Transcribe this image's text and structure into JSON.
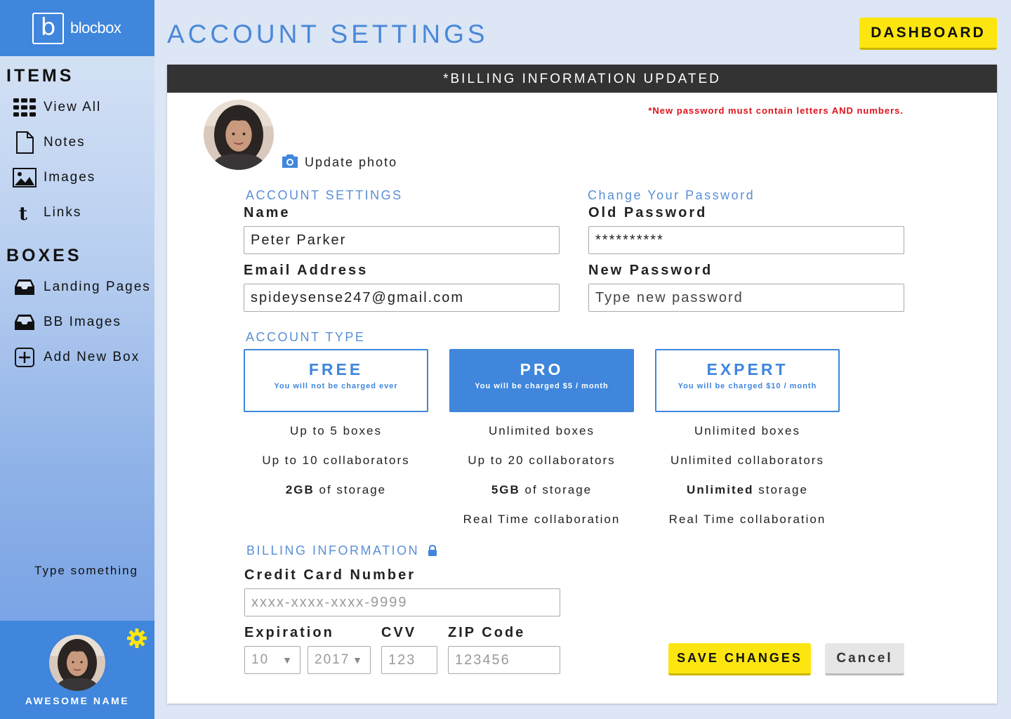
{
  "brand": {
    "logo_letter": "b",
    "name": "blocbox"
  },
  "sidebar": {
    "items_heading": "ITEMS",
    "items": [
      {
        "label": "View All",
        "icon": "grid-icon"
      },
      {
        "label": "Notes",
        "icon": "document-icon"
      },
      {
        "label": "Images",
        "icon": "image-icon"
      },
      {
        "label": "Links",
        "icon": "tumblr-icon"
      }
    ],
    "boxes_heading": "BOXES",
    "boxes": [
      {
        "label": "Landing Pages",
        "icon": "inbox-icon"
      },
      {
        "label": "BB Images",
        "icon": "inbox-icon"
      },
      {
        "label": "Add New Box",
        "icon": "plus-square-icon"
      }
    ],
    "input_placeholder": "Type something",
    "profile_name": "AWESOME NAME"
  },
  "header": {
    "title": "ACCOUNT SETTINGS",
    "dashboard_label": "DASHBOARD"
  },
  "banner": "*BILLING INFORMATION UPDATED",
  "password_warning": "*New password must contain letters AND numbers.",
  "update_photo_label": "Update photo",
  "account": {
    "heading": "ACCOUNT SETTINGS",
    "name_label": "Name",
    "name_value": "Peter Parker",
    "email_label": "Email Address",
    "email_value": "spideysense247@gmail.com"
  },
  "password": {
    "heading": "Change Your Password",
    "old_label": "Old Password",
    "old_value": "**********",
    "new_label": "New Password",
    "new_placeholder": "Type new password"
  },
  "account_type": {
    "heading": "ACCOUNT TYPE",
    "plans": [
      {
        "name": "FREE",
        "desc": "You will not be charged ever",
        "selected": false,
        "features": {
          "boxes": "Up to 5 boxes",
          "collab": "Up to 10 collaborators",
          "storage_bold": "2GB",
          "storage_rest": " of storage",
          "realtime": ""
        }
      },
      {
        "name": "PRO",
        "desc": "You will be charged $5 / month",
        "selected": true,
        "features": {
          "boxes": "Unlimited boxes",
          "collab": "Up to 20 collaborators",
          "storage_bold": "5GB",
          "storage_rest": " of storage",
          "realtime": "Real Time collaboration"
        }
      },
      {
        "name": "EXPERT",
        "desc": "You will be charged $10 / month",
        "selected": false,
        "features": {
          "boxes": "Unlimited boxes",
          "collab": "Unlimited collaborators",
          "storage_bold": "Unlimited",
          "storage_rest": " storage",
          "realtime": "Real Time collaboration"
        }
      }
    ]
  },
  "billing": {
    "heading": "BILLING INFORMATION",
    "card_label": "Credit Card Number",
    "card_placeholder": "xxxx-xxxx-xxxx-9999",
    "expiration_label": "Expiration",
    "exp_month": "10",
    "exp_year": "2017",
    "cvv_label": "CVV",
    "cvv_placeholder": "123",
    "zip_label": "ZIP Code",
    "zip_placeholder": "123456"
  },
  "actions": {
    "save": "SAVE CHANGES",
    "cancel": "Cancel"
  },
  "colors": {
    "accent": "#3f86dc",
    "yellow": "#fde60f",
    "warning": "#e0101a",
    "banner": "#333333",
    "background": "#dce6f4"
  }
}
